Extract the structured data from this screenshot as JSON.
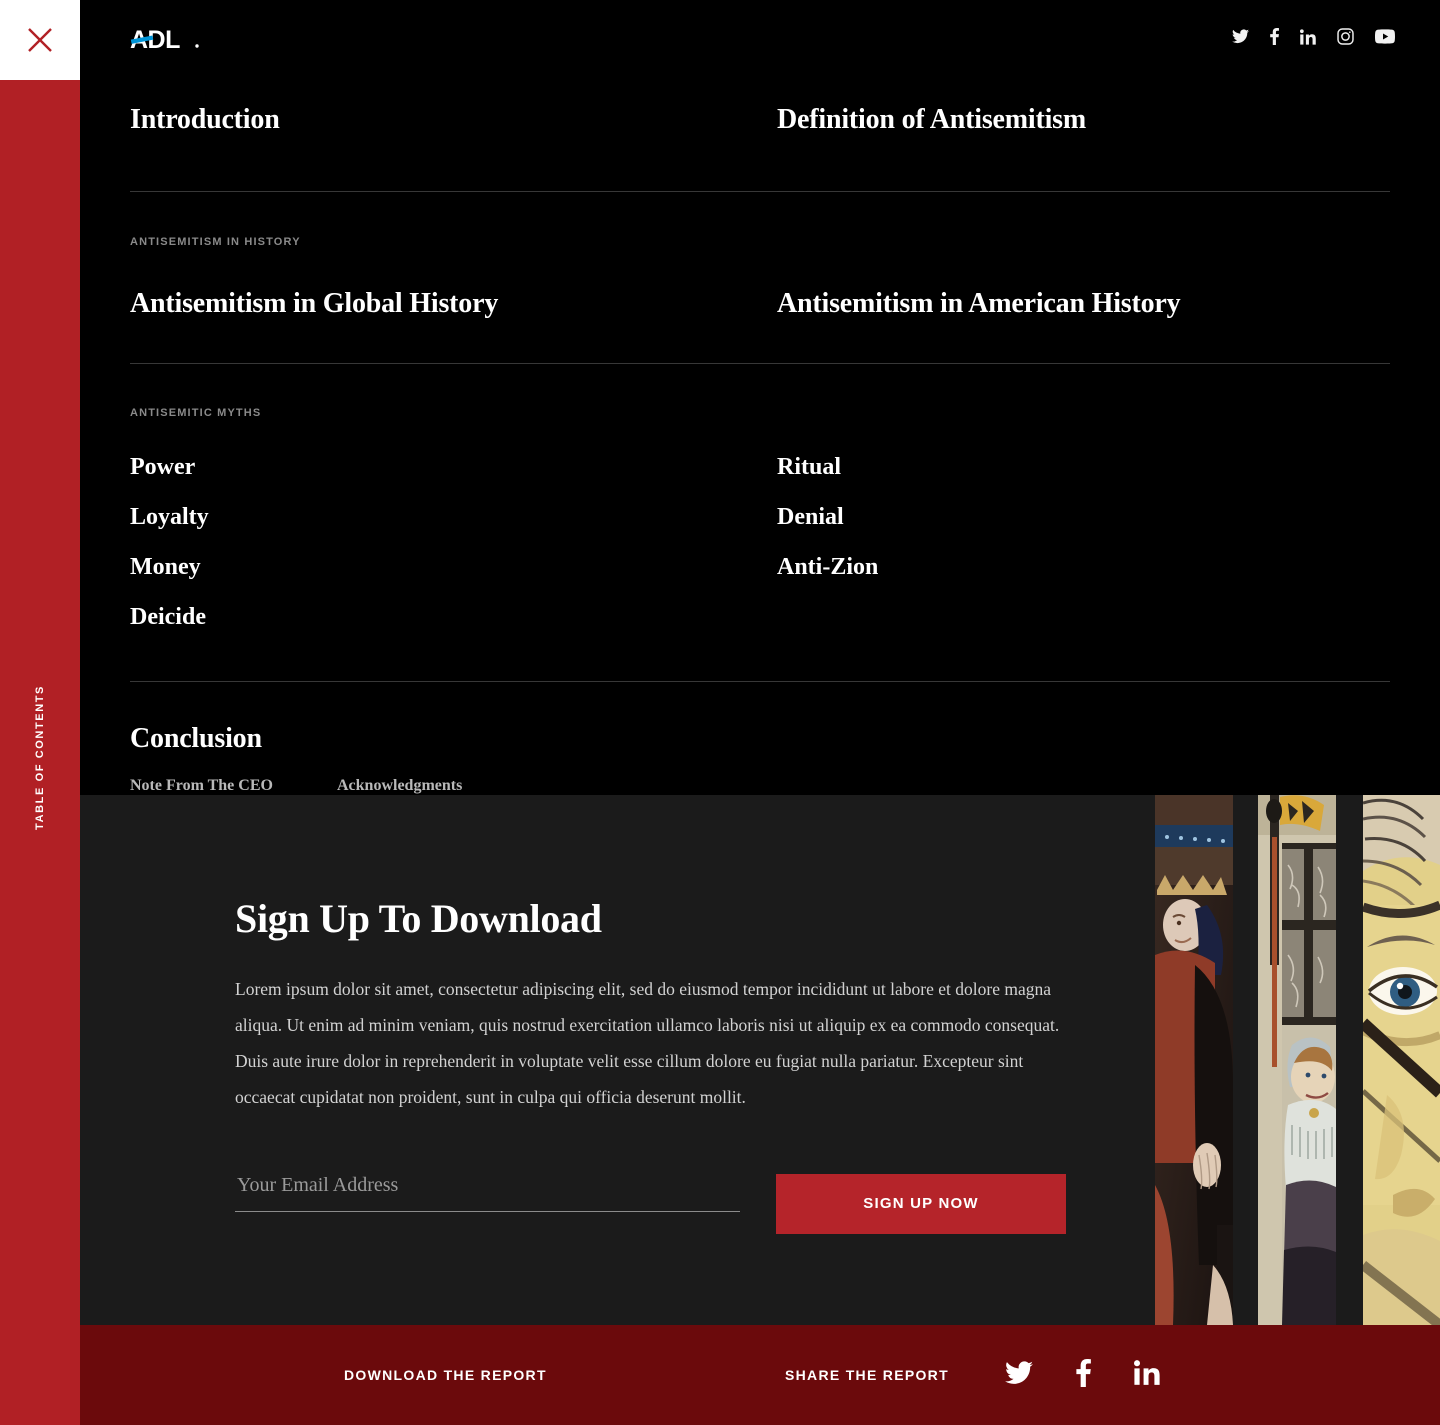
{
  "theme": {
    "rail_red": "#B12025",
    "footer_red": "#6B0A0C",
    "button_red": "#B5242A",
    "panel_black": "#000000",
    "signup_bg": "#1B1B1B",
    "logo_accent_blue": "#0095D8"
  },
  "rail": {
    "close_label": "close",
    "vertical_label": "TABLE OF CONTENTS"
  },
  "header": {
    "logo_text": "ADL",
    "social": [
      {
        "name": "twitter-icon",
        "label": "Twitter"
      },
      {
        "name": "facebook-icon",
        "label": "Facebook"
      },
      {
        "name": "linkedin-icon",
        "label": "LinkedIn"
      },
      {
        "name": "instagram-icon",
        "label": "Instagram"
      },
      {
        "name": "youtube-icon",
        "label": "YouTube"
      }
    ]
  },
  "toc": {
    "top_links": {
      "left": "Introduction",
      "right": "Definition of Antisemitism"
    },
    "history": {
      "kicker": "ANTISEMITISM IN HISTORY",
      "left": "Antisemitism in Global History",
      "right": "Antisemitism in American History"
    },
    "myths": {
      "kicker": "ANTISEMITIC MYTHS",
      "left": [
        "Power",
        "Loyalty",
        "Money",
        "Deicide"
      ],
      "right": [
        "Ritual",
        "Denial",
        "Anti-Zion"
      ]
    },
    "conclusion": {
      "title": "Conclusion",
      "links": [
        "Note From The CEO",
        "Acknowledgments"
      ]
    }
  },
  "signup": {
    "title": "Sign Up To Download",
    "body": "Lorem ipsum dolor sit amet, consectetur adipiscing elit, sed do eiusmod tempor incididunt ut labore et dolore magna aliqua. Ut enim ad minim veniam, quis nostrud exercitation ullamco laboris nisi ut aliquip ex ea commodo consequat. Duis aute irure dolor in reprehenderit in voluptate velit esse cillum dolore eu fugiat nulla pariatur. Excepteur sint occaecat cupidatat non proident, sunt in culpa qui officia deserunt mollit.",
    "email_placeholder": "Your Email Address",
    "email_value": "",
    "button_label": "SIGN UP NOW",
    "images": [
      {
        "name": "manuscript-king-strip",
        "alt": "Medieval illumination of a crowned figure in red robe"
      },
      {
        "name": "manuscript-banner-strip",
        "alt": "Medieval illumination of a figure holding a banner before a window"
      },
      {
        "name": "caricature-eye-strip",
        "alt": "Close-up of an antisemitic caricature face with spectacles"
      }
    ]
  },
  "footer": {
    "download_label": "DOWNLOAD THE REPORT",
    "share_label": "SHARE THE REPORT",
    "social": [
      {
        "name": "twitter-icon",
        "label": "Twitter"
      },
      {
        "name": "facebook-icon",
        "label": "Facebook"
      },
      {
        "name": "linkedin-icon",
        "label": "LinkedIn"
      }
    ]
  }
}
